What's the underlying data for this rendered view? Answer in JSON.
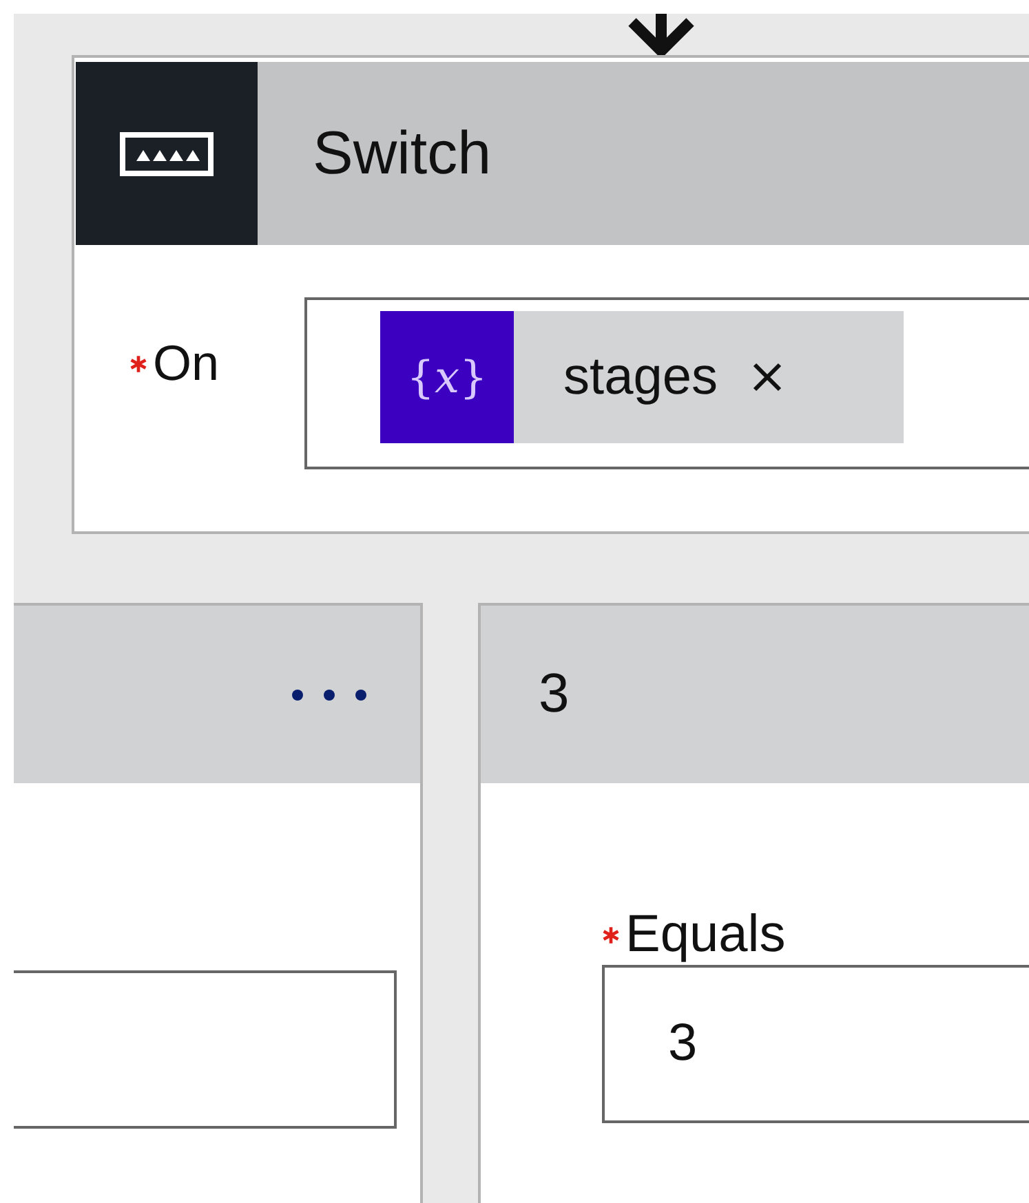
{
  "switch_card": {
    "title": "Switch",
    "on_field": {
      "label": "On",
      "required": true,
      "token": {
        "icon": "{*x*}",
        "text": "stages"
      }
    }
  },
  "cases": [
    {
      "has_menu": true
    },
    {
      "title": "3",
      "has_menu": false,
      "field": {
        "label": "Equals",
        "required": true,
        "value": "3"
      }
    }
  ]
}
